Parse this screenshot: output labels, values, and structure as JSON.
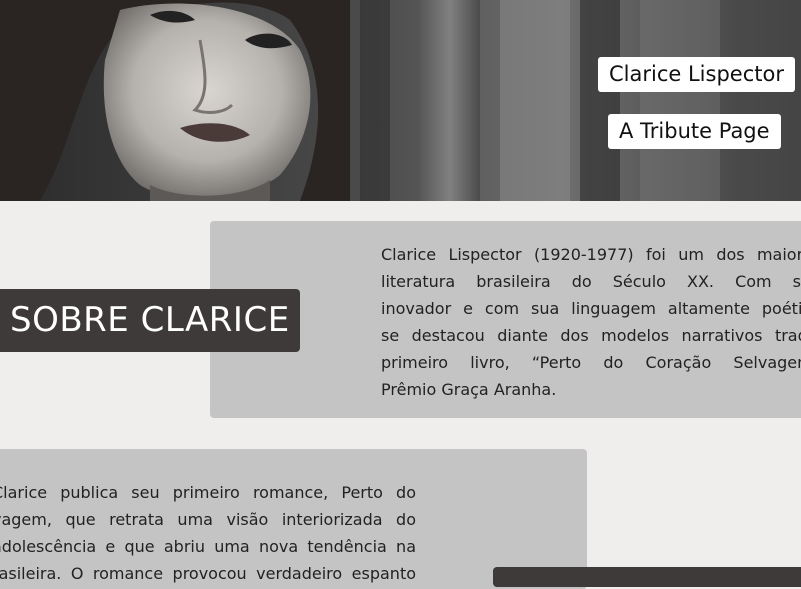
{
  "hero": {
    "name_tag": "Clarice Lispector",
    "subtitle_tag": "A Tribute Page"
  },
  "about": {
    "heading": "SOBRE CLARICE",
    "paragraph_lines": [
      "Clarice Lispector (1920-1977) foi um dos maiores",
      "literatura brasileira do Século XX. Com seu",
      "inovador e com sua linguagem altamente poética",
      "se destacou diante dos modelos narrativos tradic",
      "primeiro livro, “Perto do Coração Selvagem”",
      "Prêmio Graça Aranha."
    ]
  },
  "timeline": {
    "paragraph_lines": [
      "Clarice publica seu primeiro romance, Perto do",
      "vagem, que retrata uma visão interiorizada do",
      "adolescência e que abriu uma nova tendência na",
      "rasileira. O romance provocou verdadeiro espanto"
    ]
  }
}
